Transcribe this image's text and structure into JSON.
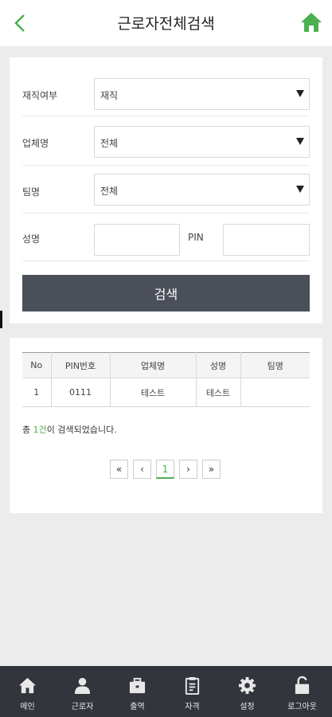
{
  "header": {
    "title": "근로자전체검색",
    "back_icon": "chevron-left-icon",
    "home_icon": "home-icon",
    "accent_color": "#4caf50"
  },
  "search_form": {
    "employment_status": {
      "label": "재직여부",
      "value": "재직"
    },
    "company": {
      "label": "업체명",
      "value": "전체"
    },
    "team": {
      "label": "팀명",
      "value": "전체"
    },
    "name": {
      "label": "성명",
      "value": ""
    },
    "pin": {
      "label": "PIN",
      "value": ""
    },
    "search_button": "검색"
  },
  "results": {
    "columns": [
      "No",
      "PIN번호",
      "업체명",
      "성명",
      "팀명"
    ],
    "rows": [
      {
        "no": "1",
        "pin": "0111",
        "company": "테스트",
        "name": "테스트",
        "team": ""
      }
    ],
    "summary_prefix": "총 ",
    "summary_count": "1건",
    "summary_suffix": "이 검색되었습니다.",
    "pagination": {
      "first": "«",
      "prev": "‹",
      "current": "1",
      "next": "›",
      "last": "»"
    }
  },
  "bottom_nav": [
    {
      "label": "메인",
      "icon": "home-icon"
    },
    {
      "label": "근로자",
      "icon": "user-icon"
    },
    {
      "label": "출역",
      "icon": "briefcase-icon"
    },
    {
      "label": "자격",
      "icon": "clipboard-icon"
    },
    {
      "label": "설정",
      "icon": "gear-icon"
    },
    {
      "label": "로그아웃",
      "icon": "unlock-icon"
    }
  ]
}
